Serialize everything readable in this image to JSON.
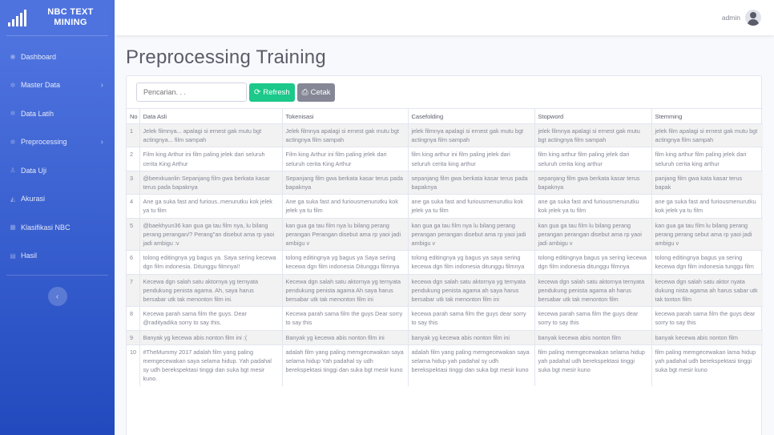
{
  "brand": {
    "title": "NBC TEXT MINING"
  },
  "sidebar": {
    "items": [
      {
        "label": "Dashboard",
        "icon": "dashboard-icon",
        "arrow": false
      },
      {
        "label": "Master Data",
        "icon": "cog-icon",
        "arrow": true
      },
      {
        "label": "Data Latih",
        "icon": "cog-icon",
        "arrow": false
      },
      {
        "label": "Preprocessing",
        "icon": "cog-icon",
        "arrow": true
      },
      {
        "label": "Data Uji",
        "icon": "user-icon",
        "arrow": false
      },
      {
        "label": "Akurasi",
        "icon": "bell-icon",
        "arrow": false
      },
      {
        "label": "Klasifikasi NBC",
        "icon": "table-icon",
        "arrow": false
      },
      {
        "label": "Hasil",
        "icon": "calendar-icon",
        "arrow": false
      }
    ],
    "toggle_icon": "chevron-left-icon"
  },
  "topbar": {
    "user": "admin"
  },
  "page": {
    "title": "Preprocessing Training"
  },
  "toolbar": {
    "search_placeholder": "Pencarian. . .",
    "refresh_label": "Refresh",
    "print_label": "Cetak"
  },
  "table": {
    "headers": [
      "No",
      "Data Asli",
      "Tokenisasi",
      "Casefolding",
      "Stopword",
      "Stemming"
    ],
    "rows": [
      [
        "1",
        "Jelek filmnya... apalagi si ernest gak mutu bgt actingnya... film sampah",
        "Jelek filmnya apalagi si ernest gak mutu bgt actingnya film sampah",
        "jelek filmnya apalagi si ernest gak mutu bgt actingnya film sampah",
        "jelek filmnya apalagi si ernest gak mutu bgt actingnya film sampah",
        "jelek film apalagi si ernest gak mutu bgt actingnya film sampah"
      ],
      [
        "2",
        "Film king Arthur ini film paling jelek dari seluruh cerita King Arthur",
        "Film king Arthur ini film paling jelek dari seluruh cerita King Arthur",
        "film king arthur ini film paling jelek dari seluruh cerita king arthur",
        "film king arthur film paling jelek dari seluruh cerita king arthur",
        "film king arthur film paling jelek dari seluruh cerita king arthur"
      ],
      [
        "3",
        "@beexkuanlin Sepanjang film gwa berkata kasar terus pada bapaknya",
        "Sepanjang film gwa berkata kasar terus pada bapaknya",
        "sepanjang film gwa berkata kasar terus pada bapaknya",
        "sepanjang film gwa berkata kasar terus bapaknya",
        "panjang film gwa kata kasar terus bapak"
      ],
      [
        "4",
        "Ane ga suka fast and furious..menurutku kok jelek ya tu film",
        "Ane ga suka fast and furiousmenurutku kok jelek ya tu film",
        "ane ga suka fast and furiousmenurutku kok jelek ya tu film",
        "ane ga suka fast and furiousmenurutku kok jelek ya tu film",
        "ane ga suka fast and furiousmenurutku kok jelek ya tu film"
      ],
      [
        "5",
        "@baekhyun36 kan gua ga tau film nya, lu bilang perang perangan/? Perang\"an disebut ama rp yaoi jadi ambigu :v",
        "kan gua ga tau film nya lu bilang perang perangan Perangan disebut ama rp yaoi jadi ambigu v",
        "kan gua ga tau film nya lu bilang perang perangan perangan disebut ama rp yaoi jadi ambigu v",
        "kan gua ga tau film lu bilang perang perangan perangan disebut ama rp yaoi jadi ambigu v",
        "kan gua ga tau film lu bilang perang perang perang sebut ama rp yaoi jadi ambigu v"
      ],
      [
        "6",
        "tolong editingnya yg bagus ya. Saya sering kecewa dgn film indonesia. Ditunggu filmnya!!",
        "tolong editingnya yg bagus ya Saya sering kecewa dgn film indonesia Ditunggu filmnya",
        "tolong editingnya yg bagus ya saya sering kecewa dgn film indonesia ditunggu filmnya",
        "tolong editingnya bagus ya sering kecewa dgn film indonesia ditunggu filmnya",
        "tolong editingnya bagus ya sering kecewa dgn film indonesia tunggu film"
      ],
      [
        "7",
        "Kecewa dgn salah satu aktornya yg ternyata pendukung penista agama. Ah, saya harus bersabar utk tak menonton film ini.",
        "Kecewa dgn salah satu aktornya yg ternyata pendukung penista agama Ah saya harus bersabar utk tak menonton film ini",
        "kecewa dgn salah satu aktornya yg ternyata pendukung penista agama ah saya harus bersabar utk tak menonton film ini",
        "kecewa dgn salah satu aktornya ternyata pendukung penista agama ah harus bersabar utk tak menonton film",
        "kecewa dgn salah satu aktor nyata dukung nista agama ah harus sabar utk tak tonton film"
      ],
      [
        "8",
        "Kecewa parah sama film the guys. Dear @radityadika sorry to say this.",
        "Kecewa parah sama film the guys Dear sorry to say this",
        "kecewa parah sama film the guys dear sorry to say this",
        "kecewa parah sama film the guys dear sorry to say this",
        "kecewa parah sama film the guys dear sorry to say this"
      ],
      [
        "9",
        "Banyak yg kecewa abis nonton film ini :(",
        "Banyak yg kecewa abis nonton film ini",
        "banyak yg kecewa abis nonton film ini",
        "banyak kecewa abis nonton film",
        "banyak kecewa abis nonton film"
      ],
      [
        "10",
        "#TheMummy 2017 adalah film yang paling memgecewakan saya selama hidup. Yah padahal sy udh berekspektasi tinggi dan suka bgt mesir kuno.",
        "adalah film yang paling memgecewakan saya selama hidup Yah padahal sy udh berekspektasi tinggi dan suka bgt mesir kuno",
        "adalah film yang paling memgecewakan saya selama hidup yah padahal sy udh berekspektasi tinggi dan suka bgt mesir kuno",
        "film paling memgecewakan selama hidup yah padahal udh berekspektasi tinggi suka bgt mesir kuno",
        "film paling memgecewakan lama hidup yah padahal udh berekspektasi tinggi suka bgt mesir kuno"
      ]
    ]
  }
}
